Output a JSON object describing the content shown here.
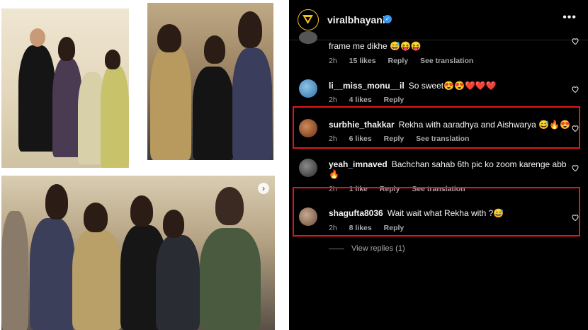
{
  "post": {
    "username": "viralbhayani",
    "verified_glyph": "✓",
    "more_glyph": "•••",
    "next_glyph": "›"
  },
  "comments": [
    {
      "user": "",
      "text": "frame me dikhe 😅😝😝",
      "time": "2h",
      "likes": "15 likes",
      "reply": "Reply",
      "translate": "See translation"
    },
    {
      "user": "li__miss_monu__il",
      "text": "So sweet😍😍❤️❤️❤️",
      "time": "2h",
      "likes": "4 likes",
      "reply": "Reply"
    },
    {
      "user": "surbhie_thakkar",
      "text": "Rekha with aaradhya and Aishwarya 😅🔥😍",
      "time": "2h",
      "likes": "6 likes",
      "reply": "Reply",
      "translate": "See translation"
    },
    {
      "user": "yeah_imnaved",
      "text": "Bachchan sahab 6th pic ko zoom karenge abb",
      "text2": "🔥",
      "time": "2h",
      "likes": "1 like",
      "reply": "Reply",
      "translate": "See translation"
    },
    {
      "user": "shagufta8036",
      "text": "Wait wait what Rekha with ?😅",
      "time": "2h",
      "likes": "8 likes",
      "reply": "Reply"
    }
  ],
  "view_replies": "View replies (1)",
  "colors": {
    "highlight": "#e0161d",
    "background": "#000000",
    "muted_text": "#a8a8a8",
    "verified": "#3897f0",
    "brand_ring": "#f0c020"
  },
  "icons": [
    "viralbhayani-logo-icon",
    "verified-icon",
    "more-options-icon",
    "heart-icon",
    "next-photo-icon"
  ]
}
